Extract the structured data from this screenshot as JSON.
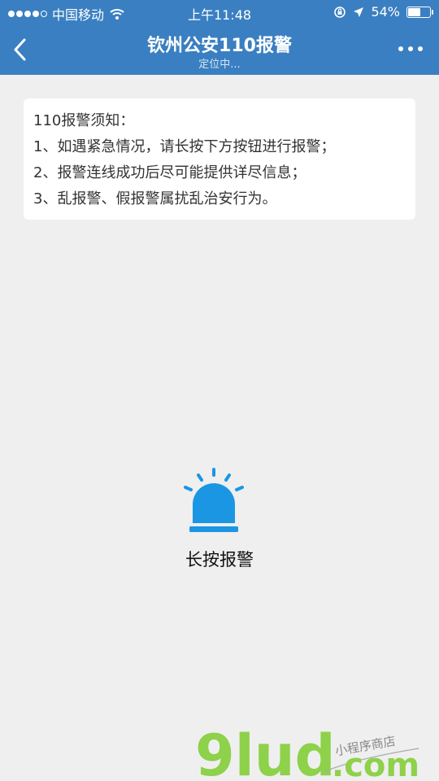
{
  "status_bar": {
    "carrier": "中国移动",
    "time": "上午11:48",
    "battery_percent": "54%",
    "battery_level": 0.54,
    "signal_bars_filled": 4,
    "signal_bars_total": 5
  },
  "nav": {
    "title": "钦州公安110报警",
    "subtitle": "定位中..."
  },
  "notice": {
    "heading": "110报警须知：",
    "items": [
      "1、如遇紧急情况，请长按下方按钮进行报警；",
      "2、报警连线成功后尽可能提供详尽信息；",
      "3、乱报警、假报警属扰乱治安行为。"
    ]
  },
  "alarm": {
    "label": "长按报警",
    "icon": "siren-icon",
    "icon_color": "#1a96e3"
  },
  "watermark": {
    "brand": "9lud",
    "domain": ".com",
    "tagline": "小程序商店",
    "brand_color": "#8ed14a"
  },
  "colors": {
    "header": "#3a7fc1",
    "background": "#efefef"
  }
}
